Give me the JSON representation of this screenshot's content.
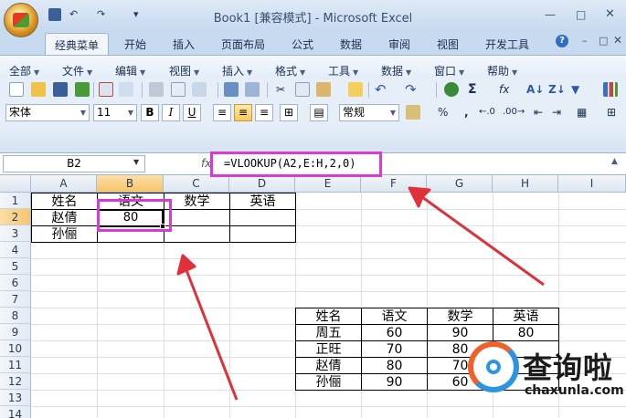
{
  "window": {
    "title": "Book1 [兼容模式] - Microsoft Excel",
    "min": "—",
    "max": "□",
    "close": "✕"
  },
  "quick_access": {
    "undo": "↶",
    "redo": "↷",
    "more": "▾"
  },
  "ribbon_tabs": [
    "经典菜单",
    "开始",
    "插入",
    "页面布局",
    "公式",
    "数据",
    "审阅",
    "视图",
    "开发工具"
  ],
  "ribbon_controls": {
    "help": "?",
    "min": "–",
    "restore": "□",
    "close": "✕"
  },
  "menus": [
    "全部",
    "文件",
    "编辑",
    "视图",
    "插入",
    "格式",
    "工具",
    "数据",
    "窗口",
    "帮助"
  ],
  "toolbar": {
    "font_name": "宋体",
    "font_size": "11",
    "bold": "B",
    "italic": "I",
    "underline": "U",
    "number_format": "常规",
    "percent": "%",
    "comma": ",",
    "sum": "Σ",
    "fx": "fx"
  },
  "formula_bar": {
    "name_box": "B2",
    "fx_label": "fx",
    "formula": "=VLOOKUP(A2,E:H,2,0)"
  },
  "columns": [
    "A",
    "B",
    "C",
    "D",
    "E",
    "F",
    "G",
    "H",
    "I"
  ],
  "rows": [
    "1",
    "2",
    "3",
    "4",
    "5",
    "6",
    "7",
    "8",
    "9",
    "10",
    "11",
    "12",
    "13",
    "14"
  ],
  "table1": {
    "headers": [
      "姓名",
      "语文",
      "数学",
      "英语"
    ],
    "rows": [
      [
        "赵倩",
        "80",
        "",
        ""
      ],
      [
        "孙俪",
        "",
        "",
        ""
      ]
    ]
  },
  "table2": {
    "headers": [
      "姓名",
      "语文",
      "数学",
      "英语"
    ],
    "rows": [
      [
        "周五",
        "60",
        "90",
        "80"
      ],
      [
        "正旺",
        "70",
        "80",
        ""
      ],
      [
        "赵倩",
        "80",
        "70",
        ""
      ],
      [
        "孙俪",
        "90",
        "60",
        ""
      ]
    ]
  },
  "watermark": {
    "title": "查询啦",
    "url": "chaxunla.com"
  },
  "colors": {
    "highlight": "#d93ad6",
    "arrow": "#e0303a"
  }
}
